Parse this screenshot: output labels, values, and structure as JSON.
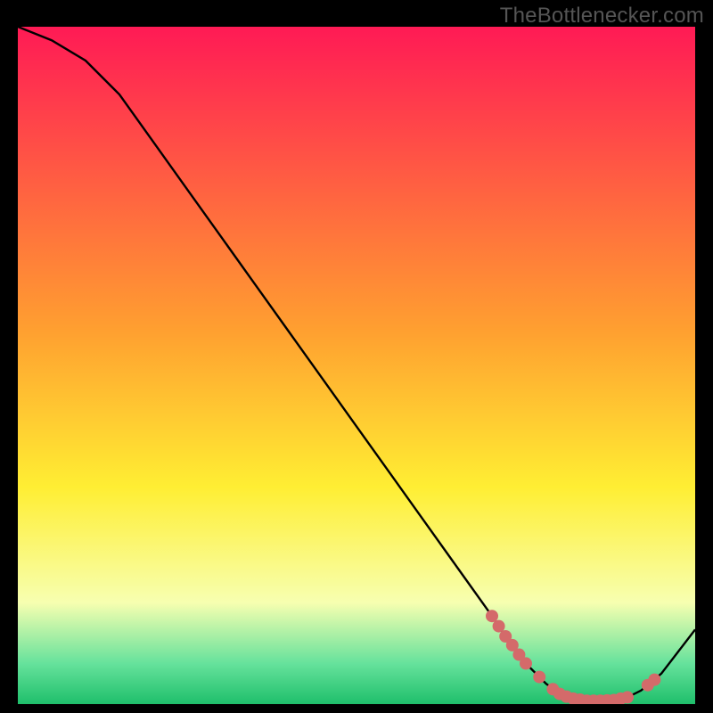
{
  "watermark": "TheBottlenecker.com",
  "colors": {
    "gradient_top": "#ff1a55",
    "gradient_mid_warm": "#ffa030",
    "gradient_yellow": "#ffee33",
    "gradient_pale": "#f7ffb0",
    "gradient_mint": "#66e29c",
    "gradient_green": "#1fbf6b",
    "curve": "#000000",
    "marker": "#d46a6a",
    "background": "#000000"
  },
  "chart_data": {
    "type": "line",
    "title": "",
    "xlabel": "",
    "ylabel": "",
    "xlim": [
      0,
      100
    ],
    "ylim": [
      0,
      100
    ],
    "x": [
      0,
      5,
      10,
      15,
      20,
      25,
      30,
      35,
      40,
      45,
      50,
      55,
      60,
      65,
      70,
      72,
      75,
      78,
      80,
      82,
      84,
      86,
      88,
      90,
      92,
      95,
      100
    ],
    "values": [
      100,
      98,
      95,
      90,
      83,
      76,
      69,
      62,
      55,
      48,
      41,
      34,
      27,
      20,
      13,
      10,
      6,
      3,
      1.5,
      0.8,
      0.5,
      0.5,
      0.6,
      1.0,
      2.0,
      4.5,
      11
    ],
    "series": [
      {
        "name": "bottleneck-curve",
        "x": [
          0,
          5,
          10,
          15,
          20,
          25,
          30,
          35,
          40,
          45,
          50,
          55,
          60,
          65,
          70,
          72,
          75,
          78,
          80,
          82,
          84,
          86,
          88,
          90,
          92,
          95,
          100
        ],
        "values": [
          100,
          98,
          95,
          90,
          83,
          76,
          69,
          62,
          55,
          48,
          41,
          34,
          27,
          20,
          13,
          10,
          6,
          3,
          1.5,
          0.8,
          0.5,
          0.5,
          0.6,
          1.0,
          2.0,
          4.5,
          11
        ]
      }
    ],
    "markers": [
      {
        "x": 70,
        "y": 13
      },
      {
        "x": 71,
        "y": 11.5
      },
      {
        "x": 72,
        "y": 10
      },
      {
        "x": 73,
        "y": 8.7
      },
      {
        "x": 74,
        "y": 7.3
      },
      {
        "x": 75,
        "y": 6
      },
      {
        "x": 77,
        "y": 4
      },
      {
        "x": 79,
        "y": 2.2
      },
      {
        "x": 80,
        "y": 1.5
      },
      {
        "x": 81,
        "y": 1.1
      },
      {
        "x": 82,
        "y": 0.8
      },
      {
        "x": 83,
        "y": 0.65
      },
      {
        "x": 84,
        "y": 0.5
      },
      {
        "x": 85,
        "y": 0.5
      },
      {
        "x": 86,
        "y": 0.5
      },
      {
        "x": 87,
        "y": 0.55
      },
      {
        "x": 88,
        "y": 0.6
      },
      {
        "x": 89,
        "y": 0.8
      },
      {
        "x": 90,
        "y": 1.0
      },
      {
        "x": 93,
        "y": 2.8
      },
      {
        "x": 94,
        "y": 3.6
      }
    ]
  }
}
